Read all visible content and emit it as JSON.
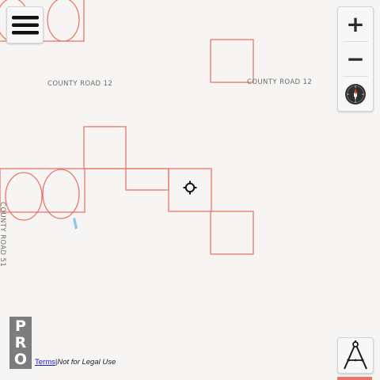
{
  "map": {
    "road_labels": [
      {
        "id": "county-road-12-west",
        "text": "COUNTY ROAD 12"
      },
      {
        "id": "county-road-12-east",
        "text": "COUNTY ROAD 12"
      },
      {
        "id": "county-road-51",
        "text": "COUNTY ROAD 51"
      }
    ],
    "colors": {
      "background": "#f7f5f3",
      "parcel_outline": "#e8776a",
      "water": "#8fc7e6",
      "pro_badge": "#7d7d7d"
    }
  },
  "controls": {
    "menu_icon": "hamburger-menu-icon",
    "zoom_in_label": "+",
    "zoom_out_label": "−",
    "compass_icon": "compass-icon",
    "compass_letter": "N",
    "locate_icon": "crosshair-icon",
    "measure_icon": "drafting-compass-icon"
  },
  "badge": {
    "letters": [
      "P",
      "R",
      "O"
    ]
  },
  "footer": {
    "terms_link": "Terms",
    "separator": "|",
    "disclaimer": "Not for Legal Use"
  }
}
